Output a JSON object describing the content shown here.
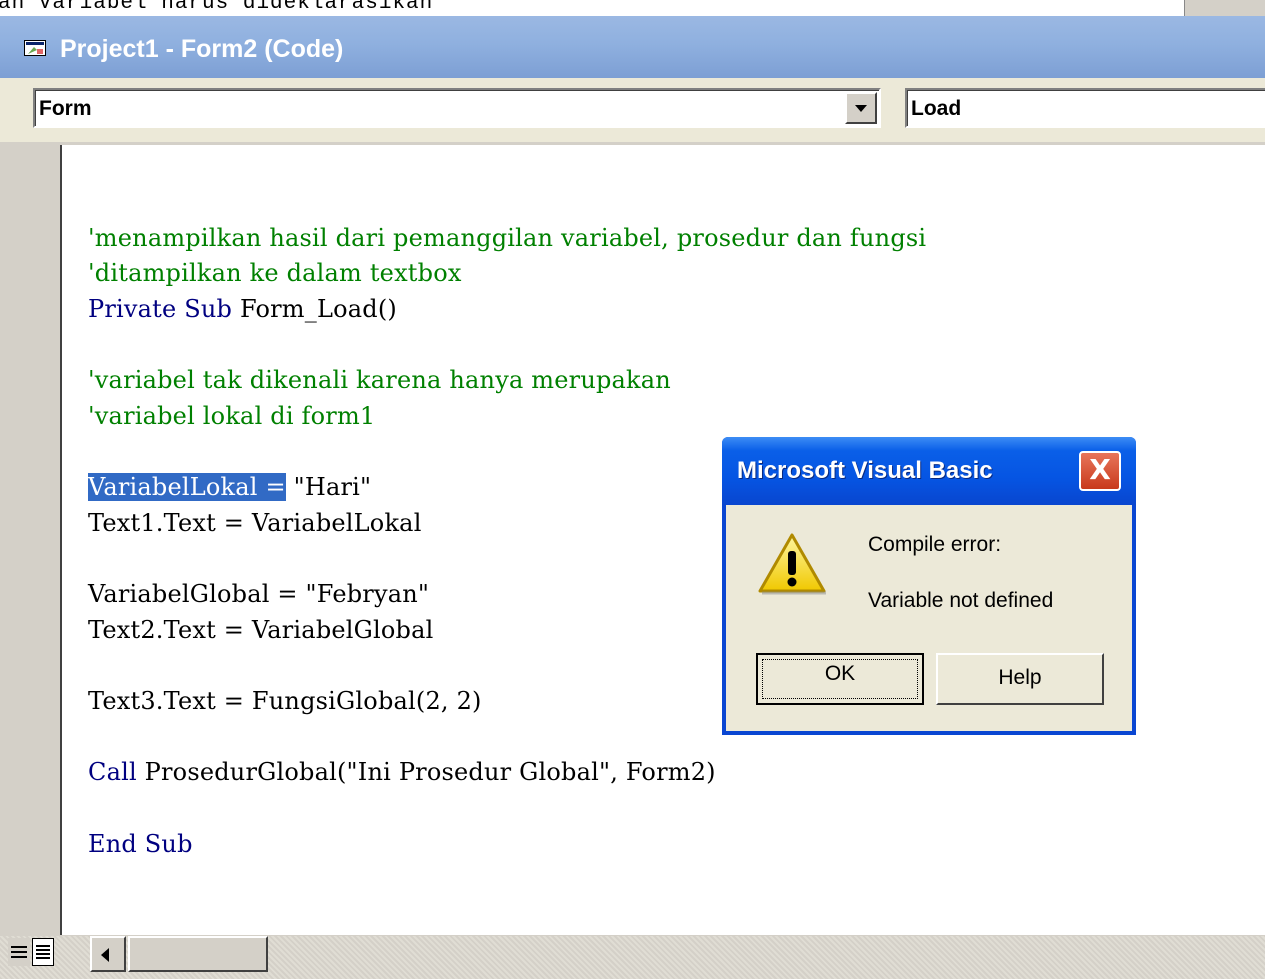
{
  "background_window": {
    "partial_text": "an Variabel harus dideklarasikan"
  },
  "window": {
    "title": "Project1 - Form2 (Code)"
  },
  "object_combo": {
    "value": "Form"
  },
  "procedure_combo": {
    "value": "Load"
  },
  "code": {
    "l1": "'menampilkan hasil dari pemanggilan variabel, prosedur dan fungsi",
    "l2": "'ditampilkan ke dalam textbox",
    "l3_kw": "Private Sub",
    "l3_rest": " Form_Load()",
    "l4": "'variabel tak dikenali karena hanya merupakan",
    "l5": "'variabel lokal di form1",
    "l6_sel": "VariabelLokal =",
    "l6_rest": " \"Hari\"",
    "l7": "Text1.Text = VariabelLokal",
    "l8": "VariabelGlobal = \"Febryan\"",
    "l9": "Text2.Text = VariabelGlobal",
    "l10": "Text3.Text = FungsiGlobal(2, 2)",
    "l11_kw": "Call",
    "l11_rest": " ProsedurGlobal(\"Ini Prosedur Global\", Form2)",
    "l12": "End Sub"
  },
  "dialog": {
    "title": "Microsoft Visual Basic",
    "close_label": "X",
    "message_line1": "Compile error:",
    "message_line2": "Variable not defined",
    "ok_label": "OK",
    "help_label": "Help",
    "icon": "warning-icon"
  },
  "colors": {
    "comment": "#008000",
    "keyword": "#000080",
    "selection": "#316ac5",
    "dialog_title": "#0655e3"
  }
}
